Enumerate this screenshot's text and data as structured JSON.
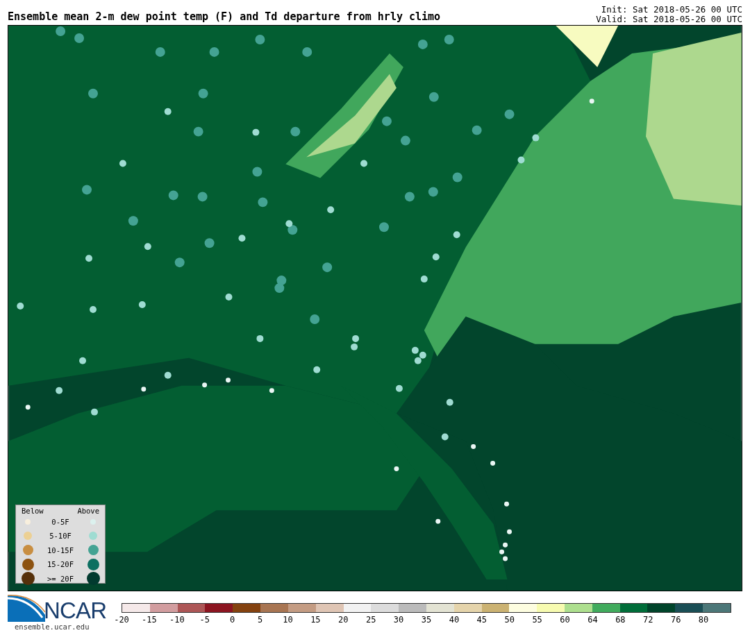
{
  "title": "Ensemble mean 2-m dew point temp (F) and Td departure from hrly climo",
  "init": "Init: Sat 2018-05-26 00 UTC",
  "valid": "Valid: Sat 2018-05-26 00 UTC",
  "legend": {
    "below_heading": "Below",
    "above_heading": "Above",
    "rows": [
      {
        "label": "0-5F",
        "below": {
          "color": "#f8efdd"
        },
        "above": {
          "color": "#dcf1ee"
        }
      },
      {
        "label": "5-10F",
        "below": {
          "color": "#ecd093"
        },
        "above": {
          "color": "#9fdcd2"
        }
      },
      {
        "label": "10-15F",
        "below": {
          "color": "#c88e41"
        },
        "above": {
          "color": "#44a393"
        }
      },
      {
        "label": "15-20F",
        "below": {
          "color": "#8c5210"
        },
        "above": {
          "color": "#0c6f61"
        }
      },
      {
        "label": ">= 20F",
        "below": {
          "color": "#55300a"
        },
        "above": {
          "color": "#023a2f"
        }
      }
    ]
  },
  "logo": {
    "text": "NCAR",
    "url": "ensemble.ucar.edu"
  },
  "colorbar": {
    "bins": [
      {
        "color": "#f5e9e9",
        "tick": "-20"
      },
      {
        "color": "#d29d9f",
        "tick": "-15"
      },
      {
        "color": "#ad5656",
        "tick": "-10"
      },
      {
        "color": "#8c1520",
        "tick": "-5"
      },
      {
        "color": "#84420f",
        "tick": "0"
      },
      {
        "color": "#a87552",
        "tick": "5"
      },
      {
        "color": "#c49c83",
        "tick": "10"
      },
      {
        "color": "#dfc5b4",
        "tick": "15"
      },
      {
        "color": "#f2f2f2",
        "tick": "20"
      },
      {
        "color": "#dcdcdc",
        "tick": "25"
      },
      {
        "color": "#bbbbbb",
        "tick": "30"
      },
      {
        "color": "#e3e3d3",
        "tick": "35"
      },
      {
        "color": "#e5d4ab",
        "tick": "40"
      },
      {
        "color": "#cbb272",
        "tick": "45"
      },
      {
        "color": "#fdfde0",
        "tick": "50"
      },
      {
        "color": "#f7fbb0",
        "tick": "55"
      },
      {
        "color": "#addf8e",
        "tick": "60"
      },
      {
        "color": "#41ab5d",
        "tick": "64"
      },
      {
        "color": "#006d39",
        "tick": "68"
      },
      {
        "color": "#00442a",
        "tick": "72"
      },
      {
        "color": "#1a4e55",
        "tick": "76"
      },
      {
        "color": "#4c7778",
        "tick": "80"
      }
    ]
  }
}
